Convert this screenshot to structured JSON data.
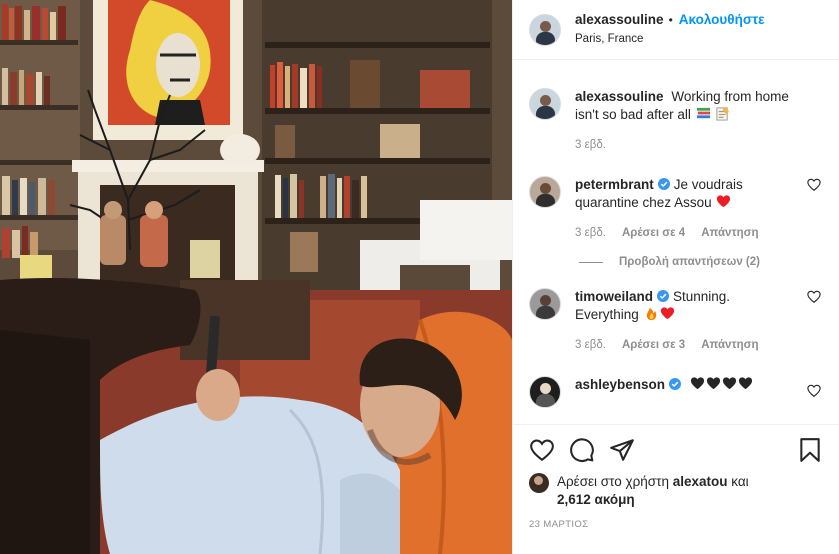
{
  "post": {
    "author": "alexassouline",
    "follow_label": "Ακολουθήστε",
    "location": "Paris, France",
    "caption_text": "Working from home isn't so bad after all",
    "caption_time": "3 εβδ."
  },
  "comments": [
    {
      "user": "petermbrant",
      "verified": true,
      "text": "Je voudrais quarantine chez Assou",
      "time": "3 εβδ.",
      "likes": "Αρέσει σε 4",
      "reply": "Απάντηση",
      "view_replies": "Προβολή απαντήσεων (2)"
    },
    {
      "user": "timoweiland",
      "verified": true,
      "text": "Stunning. Everything",
      "time": "3 εβδ.",
      "likes": "Αρέσει σε 3",
      "reply": "Απάντηση"
    },
    {
      "user": "ashleybenson",
      "verified": true,
      "text": ""
    }
  ],
  "likes_summary": {
    "prefix": "Αρέσει στο χρήστη",
    "user": "alexatou",
    "middle": "και",
    "count": "2,612 ακόμη"
  },
  "date": "23 ΜΑΡΤΙΟΣ",
  "colors": {
    "accent": "#0095f6",
    "verified": "#3897f0",
    "heart_red": "#ed1c24",
    "muted": "#8e8e8e"
  },
  "icons": {
    "like": "heart-outline-icon",
    "comment": "comment-bubble-icon",
    "share": "paper-plane-icon",
    "save": "bookmark-icon"
  }
}
